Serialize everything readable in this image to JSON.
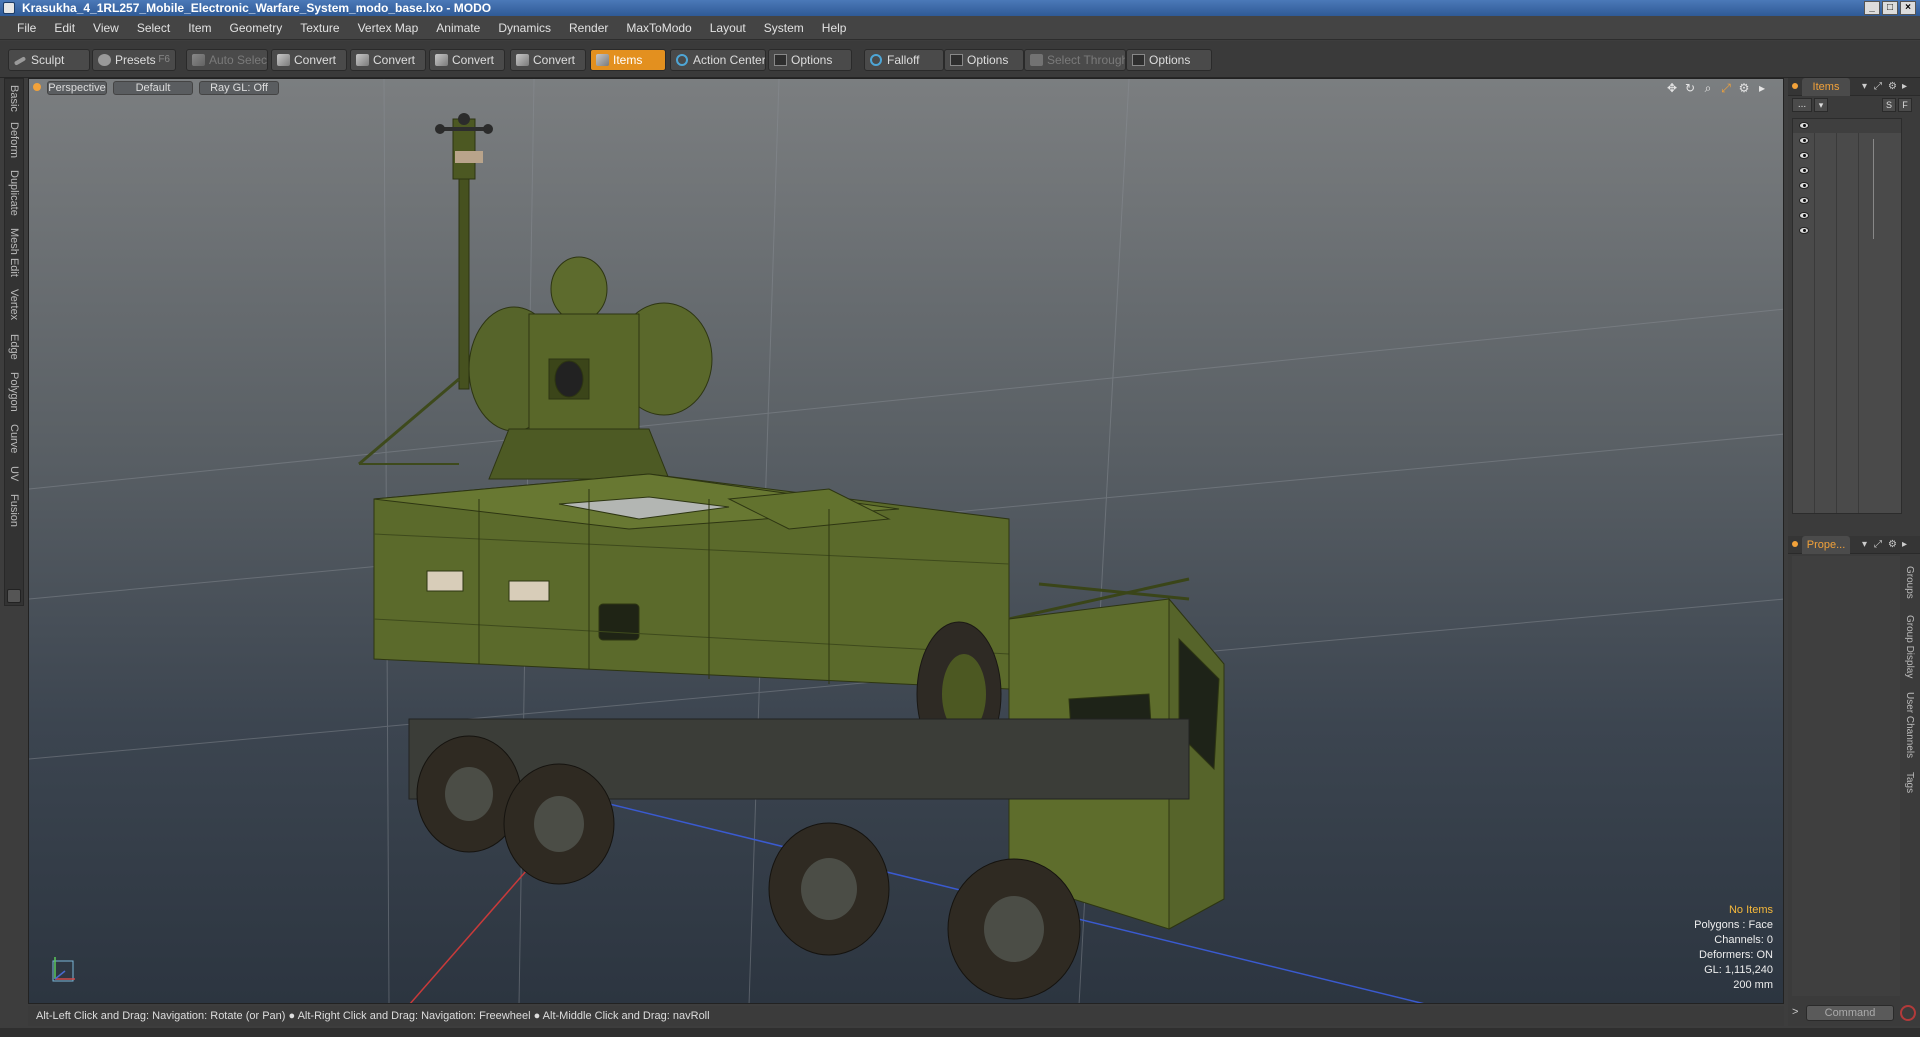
{
  "window": {
    "title": "Krasukha_4_1RL257_Mobile_Electronic_Warfare_System_modo_base.lxo - MODO",
    "controls": [
      "_",
      "□",
      "×"
    ]
  },
  "menu": [
    "File",
    "Edit",
    "View",
    "Select",
    "Item",
    "Geometry",
    "Texture",
    "Vertex Map",
    "Animate",
    "Dynamics",
    "Render",
    "MaxToModo",
    "Layout",
    "System",
    "Help"
  ],
  "toolbar": {
    "sculpt": "Sculpt",
    "presets": "Presets",
    "presets_key": "F6",
    "auto_select": "Auto Select",
    "convert_1": "Convert",
    "convert_2": "Convert",
    "convert_3": "Convert",
    "convert_4": "Convert",
    "items": "Items",
    "action_center": "Action Center",
    "options_1": "Options",
    "falloff": "Falloff",
    "options_2": "Options",
    "select_through": "Select Through",
    "options_3": "Options"
  },
  "left_tabs": [
    "Basic",
    "Deform",
    "Duplicate",
    "Mesh Edit",
    "Vertex",
    "Edge",
    "Polygon",
    "Curve",
    "UV",
    "Fusion"
  ],
  "viewport": {
    "view": "Perspective",
    "shading": "Default",
    "raygl": "Ray GL: Off",
    "info": {
      "selection": "No Items",
      "polygons": "Polygons : Face",
      "channels": "Channels: 0",
      "deformers": "Deformers: ON",
      "gl": "GL: 1,115,240",
      "scale": "200 mm"
    }
  },
  "status_bar": "Alt-Left Click and Drag: Navigation: Rotate (or Pan) ● Alt-Right Click and Drag: Navigation: Freewheel ● Alt-Middle Click and Drag: navRoll",
  "right_panel": {
    "items_tab": "Items",
    "items_menu": "...",
    "btn_s": "S",
    "btn_f": "F",
    "properties_tab": "Prope...",
    "side_tabs": [
      "Groups",
      "Group Display",
      "User Channels",
      "Tags"
    ],
    "command_placeholder": "Command",
    "command_prompt": ">"
  },
  "colors": {
    "accent": "#e3901f",
    "title_bar": "#3a67a8",
    "vehicle_green": "#5d6b2c"
  }
}
